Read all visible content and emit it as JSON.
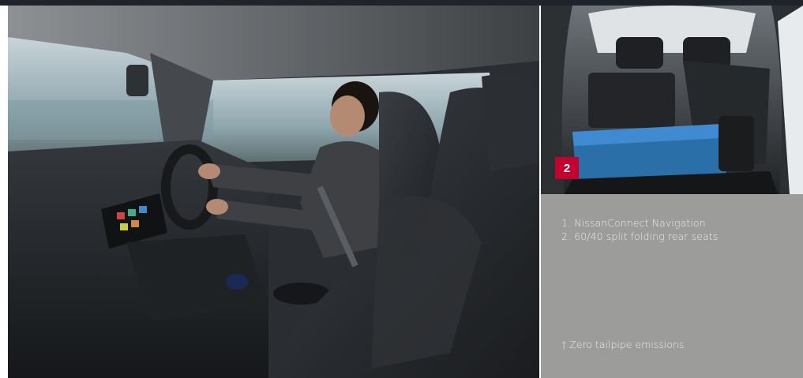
{
  "badge": {
    "number": "2"
  },
  "captions": [
    {
      "text": "1.  NissanConnect Navigation"
    },
    {
      "text": "2.  60/40 split folding rear seats"
    }
  ],
  "footnote": "† Zero tailpipe emissions",
  "colors": {
    "badge_red": "#c3002f",
    "panel_grey": "#9c9c9b",
    "caption_text": "#ececec",
    "top_bar": "#1d242c"
  },
  "images": {
    "main_photo": "car-interior-driver-photo",
    "boot_photo": "car-boot-folded-seats-photo"
  }
}
